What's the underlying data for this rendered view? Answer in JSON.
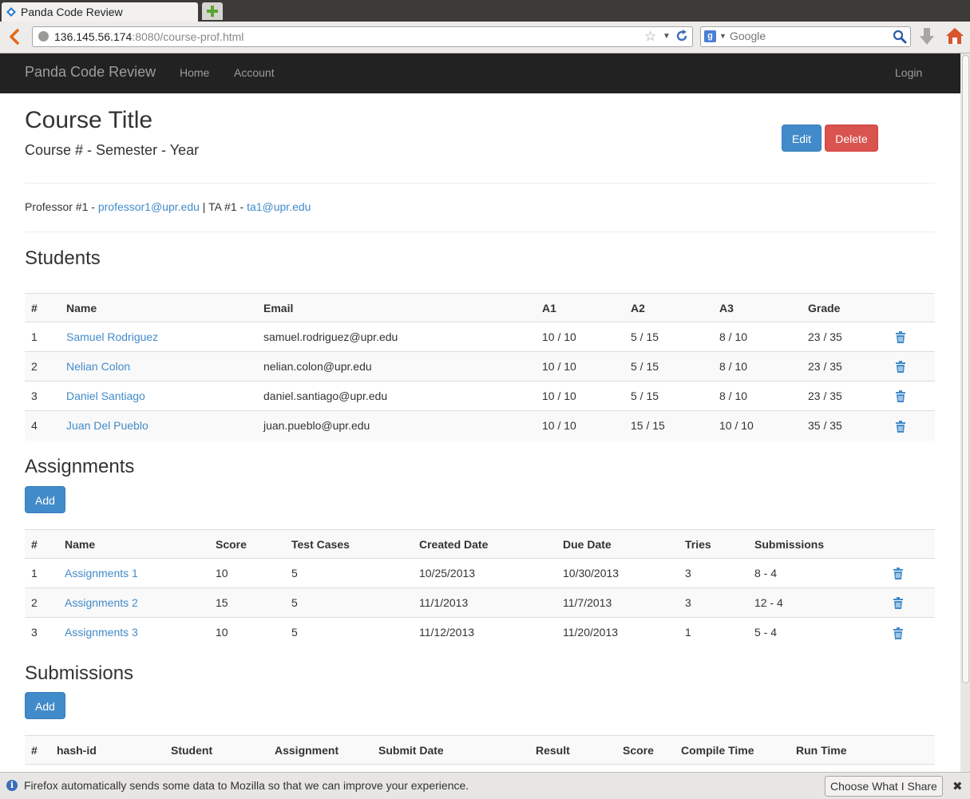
{
  "browser": {
    "tab_title": "Panda Code Review",
    "url_host": "136.145.56.174",
    "url_rest": ":8080/course-prof.html",
    "search_engine": "Google",
    "search_placeholder": "Google"
  },
  "site_nav": {
    "brand": "Panda Code Review",
    "links": [
      "Home",
      "Account"
    ],
    "login": "Login",
    "bg_color": "#222222"
  },
  "course": {
    "title": "Course Title",
    "subtitle": "Course # - Semester - Year",
    "edit_label": "Edit",
    "delete_label": "Delete"
  },
  "staff": {
    "professor_label": "Professor #1 - ",
    "professor_email": "professor1@upr.edu",
    "separator": " | ",
    "ta_label": "TA #1 - ",
    "ta_email": "ta1@upr.edu"
  },
  "students": {
    "title": "Students",
    "headers": [
      "#",
      "Name",
      "Email",
      "A1",
      "A2",
      "A3",
      "Grade"
    ],
    "rows": [
      {
        "n": "1",
        "name": "Samuel Rodriguez",
        "email": "samuel.rodriguez@upr.edu",
        "a1": "10 / 10",
        "a2": "5 / 15",
        "a3": "8 / 10",
        "grade": "23 / 35"
      },
      {
        "n": "2",
        "name": "Nelian Colon",
        "email": "nelian.colon@upr.edu",
        "a1": "10 / 10",
        "a2": "5 / 15",
        "a3": "8 / 10",
        "grade": "23 / 35"
      },
      {
        "n": "3",
        "name": "Daniel Santiago",
        "email": "daniel.santiago@upr.edu",
        "a1": "10 / 10",
        "a2": "5 / 15",
        "a3": "8 / 10",
        "grade": "23 / 35"
      },
      {
        "n": "4",
        "name": "Juan Del Pueblo",
        "email": "juan.pueblo@upr.edu",
        "a1": "10 / 10",
        "a2": "15 / 15",
        "a3": "10 / 10",
        "grade": "35 / 35"
      }
    ]
  },
  "assignments": {
    "title": "Assignments",
    "add_label": "Add",
    "headers": [
      "#",
      "Name",
      "Score",
      "Test Cases",
      "Created Date",
      "Due Date",
      "Tries",
      "Submissions"
    ],
    "rows": [
      {
        "n": "1",
        "name": "Assignments 1",
        "score": "10",
        "tests": "5",
        "created": "10/25/2013",
        "due": "10/30/2013",
        "tries": "3",
        "subs": "8 - 4"
      },
      {
        "n": "2",
        "name": "Assignments 2",
        "score": "15",
        "tests": "5",
        "created": "11/1/2013",
        "due": "11/7/2013",
        "tries": "3",
        "subs": "12 - 4"
      },
      {
        "n": "3",
        "name": "Assignments 3",
        "score": "10",
        "tests": "5",
        "created": "11/12/2013",
        "due": "11/20/2013",
        "tries": "1",
        "subs": "5 - 4"
      }
    ]
  },
  "submissions": {
    "title": "Submissions",
    "add_label": "Add",
    "headers": [
      "#",
      "hash-id",
      "Student",
      "Assignment",
      "Submit Date",
      "Result",
      "Score",
      "Compile Time",
      "Run Time"
    ]
  },
  "notification": {
    "message": "Firefox automatically sends some data to Mozilla so that we can improve your experience.",
    "button": "Choose What I Share",
    "close": "✖"
  },
  "colors": {
    "primary": "#428bca",
    "danger": "#d9534f",
    "link": "#428bca"
  }
}
